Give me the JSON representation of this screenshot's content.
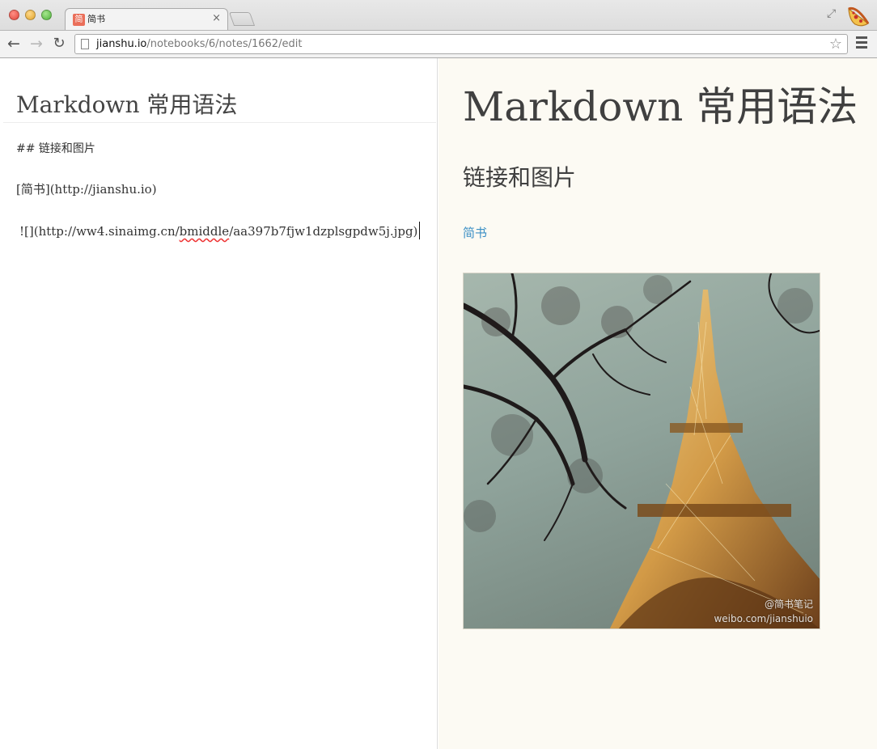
{
  "browser": {
    "tab": {
      "favicon_char": "简",
      "title": "简书",
      "close_glyph": "×"
    },
    "omnibox": {
      "url_host": "jianshu.io",
      "url_path": "/notebooks/6/notes/1662/edit"
    },
    "icons": {
      "back": "←",
      "forward": "→",
      "reload": "↻",
      "star": "☆",
      "fullscreen": "⤢"
    }
  },
  "editor": {
    "title": "Markdown 常用语法",
    "lines": [
      "## 链接和图片",
      "[简书](http://jianshu.io)",
      "![](http://ww4.sinaimg.cn/",
      "bmiddle",
      "/aa397b7fjw1dzplsgpdw5j.jpg)"
    ]
  },
  "preview": {
    "title": "Markdown 常用语法",
    "heading": "链接和图片",
    "link_text": "简书",
    "image": {
      "watermark_line1": "@简书笔记",
      "watermark_line2": "weibo.com/jianshuio"
    }
  },
  "colors": {
    "link": "#3b8fc5",
    "preview_bg": "#fcfaf3",
    "accent_favicon": "#ea6f5a"
  }
}
